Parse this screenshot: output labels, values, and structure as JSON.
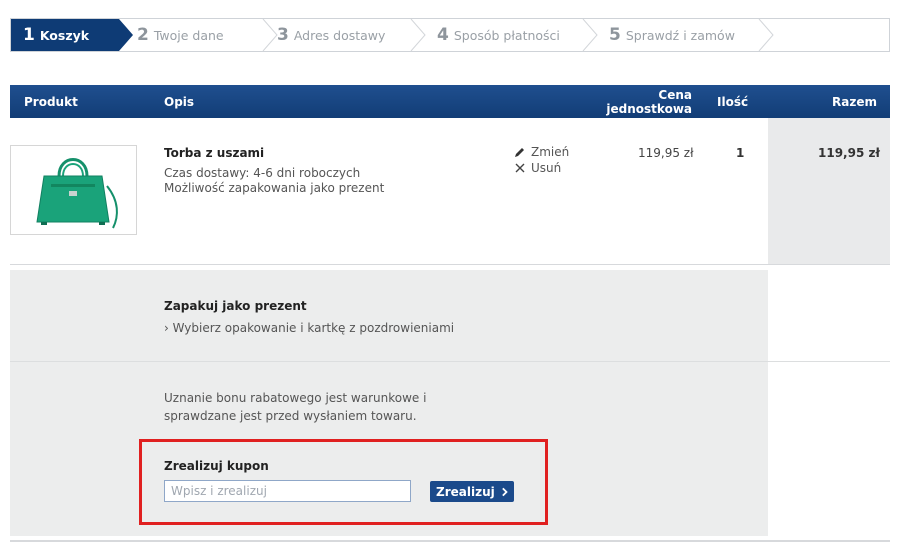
{
  "steps": [
    {
      "num": "1",
      "label": "Koszyk"
    },
    {
      "num": "2",
      "label": "Twoje dane"
    },
    {
      "num": "3",
      "label": "Adres dostawy"
    },
    {
      "num": "4",
      "label": "Sposób płatności"
    },
    {
      "num": "5",
      "label": "Sprawdź i zamów"
    }
  ],
  "table": {
    "headers": {
      "product": "Produkt",
      "description": "Opis",
      "unit_price_line1": "Cena",
      "unit_price_line2": "jednostkowa",
      "quantity": "Ilość",
      "total": "Razem"
    }
  },
  "item": {
    "title": "Torba z uszami",
    "delivery": "Czas dostawy: 4-6 dni roboczych",
    "gift_option": "Możliwość zapakowania jako prezent",
    "change_label": "Zmień",
    "remove_label": "Usuń",
    "unit_price": "119,95 zł",
    "quantity": "1",
    "total": "119,95 zł"
  },
  "gift": {
    "title": "Zapakuj jako prezent",
    "link": "› Wybierz opakowanie i kartkę z pozdrowieniami"
  },
  "coupon": {
    "note": "Uznanie bonu rabatowego jest warunkowe i sprawdzane jest przed wysłaniem towaru.",
    "title": "Zrealizuj kupon",
    "placeholder": "Wpisz i zrealizuj",
    "button_label": "Zrealizuj"
  },
  "colors": {
    "accent": "#0e3b75",
    "highlight": "#e02020",
    "product": "#1aa37a"
  }
}
